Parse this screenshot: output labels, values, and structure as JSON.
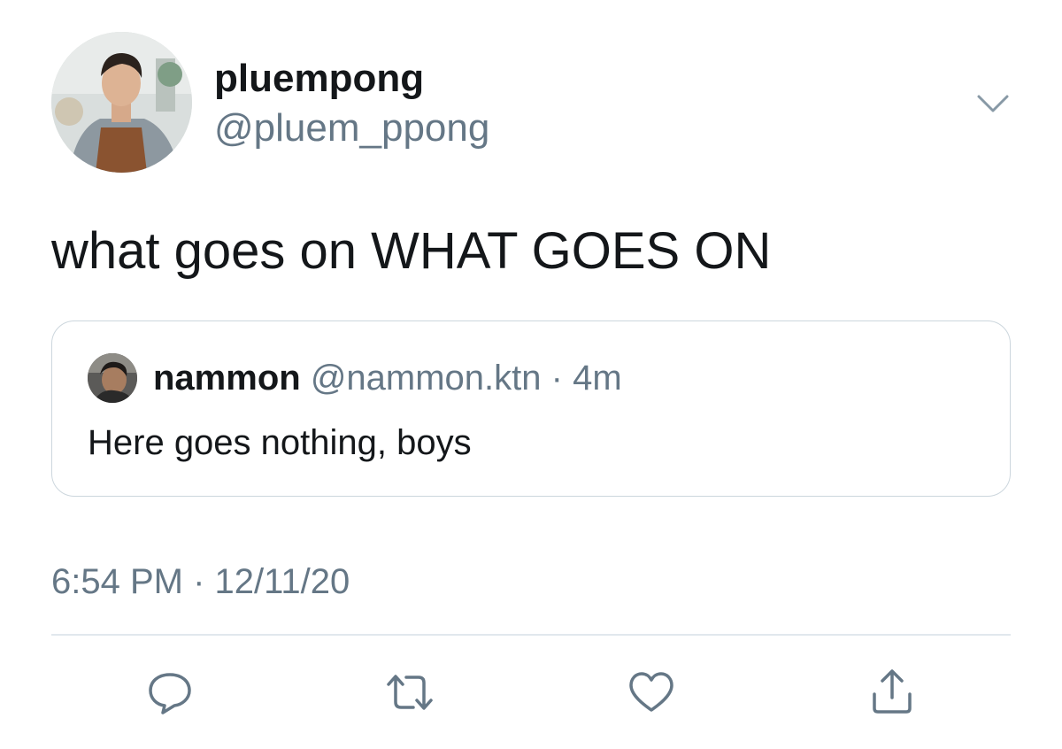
{
  "author": {
    "display_name": "pluempong",
    "handle": "@pluem_ppong"
  },
  "tweet": {
    "text": "what goes on WHAT GOES ON",
    "timestamp": "6:54 PM · 12/11/20"
  },
  "quoted_tweet": {
    "display_name": "nammon",
    "handle": "@nammon.ktn",
    "separator": "·",
    "relative_time": "4m",
    "text": "Here goes nothing, boys"
  },
  "actions": {
    "reply_icon": "reply-icon",
    "retweet_icon": "retweet-icon",
    "like_icon": "heart-icon",
    "share_icon": "share-icon"
  },
  "colors": {
    "text": "#14171a",
    "secondary": "#657786",
    "border": "#ccd6dd",
    "divider": "#e1e8ed"
  }
}
